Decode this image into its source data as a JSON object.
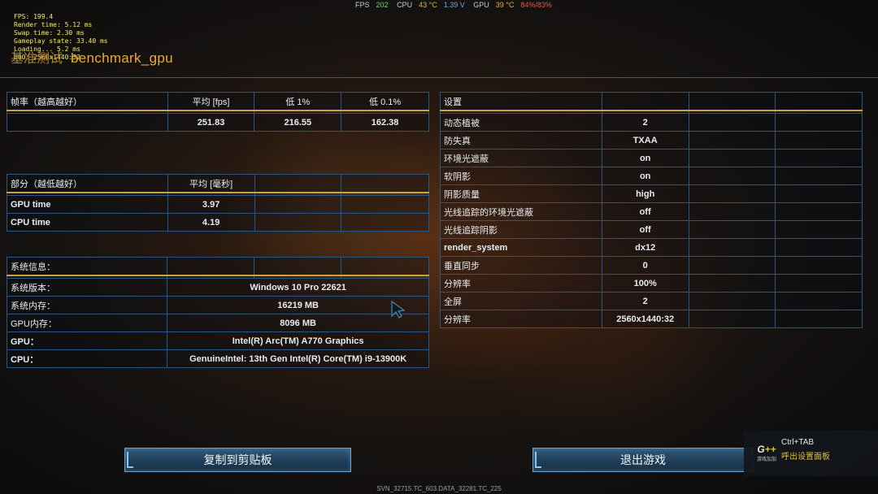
{
  "overlay": {
    "fps": "FPS: 199.4",
    "render_time": "Render time: 5.12 ms",
    "swap_time": "Swap time: 2.30 ms",
    "gameplay_state": "Gameplay state: 33.40 ms",
    "line5": "Loading... 5.2 ms",
    "resolution": "000: 2560x1440:32"
  },
  "hwbar": {
    "fps_label": "FPS",
    "fps_value": "202",
    "cpu_label": "CPU",
    "cpu_temp": "43 °C",
    "cpu_volt": "1.39 V",
    "gpu_label": "GPU",
    "gpu_temp": "39 °C",
    "gpu_load": "84%/83%"
  },
  "title": {
    "prefix": "基准测试",
    "name": "benchmark_gpu"
  },
  "fps_table": {
    "header": [
      "帧率（越高越好）",
      "平均 [fps]",
      "低 1%",
      "低 0.1%"
    ],
    "row": [
      "",
      "251.83",
      "216.55",
      "162.38"
    ]
  },
  "parts_table": {
    "header": [
      "部分（越低越好）",
      "平均 [毫秒]",
      "",
      ""
    ],
    "rows": [
      [
        "GPU time",
        "3.97"
      ],
      [
        "CPU time",
        "4.19"
      ]
    ]
  },
  "sys_table": {
    "header": "系统信息：",
    "rows": [
      [
        "系统版本：",
        "Windows 10 Pro 22621"
      ],
      [
        "系统内存：",
        "16219 MB"
      ],
      [
        "GPU内存：",
        "8096 MB"
      ],
      [
        "GPU：",
        "Intel(R) Arc(TM) A770 Graphics"
      ],
      [
        "CPU：",
        "GenuineIntel: 13th Gen Intel(R) Core(TM) i9-13900K"
      ]
    ]
  },
  "settings_table": {
    "header": "设置",
    "rows": [
      [
        "动态植被",
        "2"
      ],
      [
        "防失真",
        "TXAA"
      ],
      [
        "环境光遮蔽",
        "on"
      ],
      [
        "软阴影",
        "on"
      ],
      [
        "阴影质量",
        "high"
      ],
      [
        "光线追踪的环境光遮蔽",
        "off"
      ],
      [
        "光线追踪阴影",
        "off"
      ],
      [
        "render_system",
        "dx12"
      ],
      [
        "垂直同步",
        "0"
      ],
      [
        "分辨率",
        "100%"
      ],
      [
        "全屏",
        "2"
      ],
      [
        "分辨率",
        "2560x1440:32"
      ]
    ]
  },
  "buttons": {
    "copy": "复制到剪贴板",
    "exit": "退出游戏"
  },
  "popup": {
    "logo_text": "G",
    "logo_plus": "++",
    "logo_sub": "游戏加加",
    "shortcut": "Ctrl+TAB",
    "hint": "呼出设置面板"
  },
  "footer": "SVN_32715.TC_603.DATA_32281.TC_225"
}
